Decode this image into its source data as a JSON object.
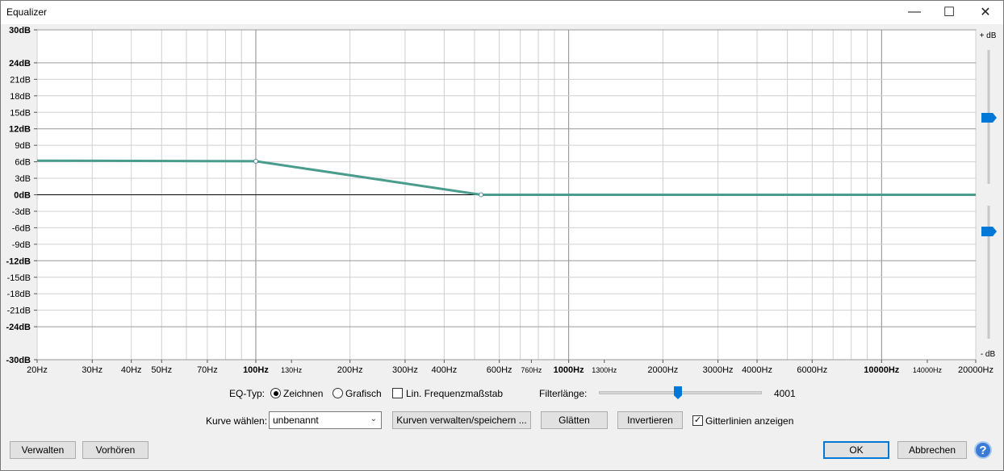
{
  "window": {
    "title": "Equalizer",
    "minimize": "—",
    "maximize": "☐",
    "close": "✕"
  },
  "graph": {
    "db_labels": [
      {
        "t": "30dB",
        "v": 30,
        "bold": true
      },
      {
        "t": "24dB",
        "v": 24,
        "bold": true
      },
      {
        "t": "21dB",
        "v": 21,
        "bold": false
      },
      {
        "t": "18dB",
        "v": 18,
        "bold": false
      },
      {
        "t": "15dB",
        "v": 15,
        "bold": false
      },
      {
        "t": "12dB",
        "v": 12,
        "bold": true
      },
      {
        "t": "9dB",
        "v": 9,
        "bold": false
      },
      {
        "t": "6dB",
        "v": 6,
        "bold": false
      },
      {
        "t": "3dB",
        "v": 3,
        "bold": false
      },
      {
        "t": "0dB",
        "v": 0,
        "bold": true
      },
      {
        "t": "-3dB",
        "v": -3,
        "bold": false
      },
      {
        "t": "-6dB",
        "v": -6,
        "bold": false
      },
      {
        "t": "-9dB",
        "v": -9,
        "bold": false
      },
      {
        "t": "-12dB",
        "v": -12,
        "bold": true
      },
      {
        "t": "-15dB",
        "v": -15,
        "bold": false
      },
      {
        "t": "-18dB",
        "v": -18,
        "bold": false
      },
      {
        "t": "-21dB",
        "v": -21,
        "bold": false
      },
      {
        "t": "-24dB",
        "v": -24,
        "bold": true
      },
      {
        "t": "-30dB",
        "v": -30,
        "bold": true
      }
    ],
    "freq_labels": [
      {
        "t": "20Hz",
        "f": 20,
        "size": "m",
        "bold": false
      },
      {
        "t": "30Hz",
        "f": 30,
        "size": "m",
        "bold": false
      },
      {
        "t": "40Hz",
        "f": 40,
        "size": "m",
        "bold": false
      },
      {
        "t": "50Hz",
        "f": 50,
        "size": "m",
        "bold": false
      },
      {
        "t": "70Hz",
        "f": 70,
        "size": "m",
        "bold": false
      },
      {
        "t": "100Hz",
        "f": 100,
        "size": "m",
        "bold": true
      },
      {
        "t": "130Hz",
        "f": 130,
        "size": "s",
        "bold": false
      },
      {
        "t": "200Hz",
        "f": 200,
        "size": "m",
        "bold": false
      },
      {
        "t": "300Hz",
        "f": 300,
        "size": "m",
        "bold": false
      },
      {
        "t": "400Hz",
        "f": 400,
        "size": "m",
        "bold": false
      },
      {
        "t": "600Hz",
        "f": 600,
        "size": "m",
        "bold": false
      },
      {
        "t": "760Hz",
        "f": 760,
        "size": "s",
        "bold": false
      },
      {
        "t": "1000Hz",
        "f": 1000,
        "size": "m",
        "bold": true
      },
      {
        "t": "1300Hz",
        "f": 1300,
        "size": "s",
        "bold": false
      },
      {
        "t": "2000Hz",
        "f": 2000,
        "size": "m",
        "bold": false
      },
      {
        "t": "3000Hz",
        "f": 3000,
        "size": "m",
        "bold": false
      },
      {
        "t": "4000Hz",
        "f": 4000,
        "size": "m",
        "bold": false
      },
      {
        "t": "6000Hz",
        "f": 6000,
        "size": "m",
        "bold": false
      },
      {
        "t": "10000Hz",
        "f": 10000,
        "size": "m",
        "bold": true
      },
      {
        "t": "14000Hz",
        "f": 14000,
        "size": "s",
        "bold": false
      },
      {
        "t": "20000Hz",
        "f": 20000,
        "size": "m",
        "bold": false
      }
    ],
    "curve": [
      {
        "f": 20,
        "db": 6.2
      },
      {
        "f": 100,
        "db": 6.1
      },
      {
        "f": 525,
        "db": 0
      },
      {
        "f": 20000,
        "db": 0
      }
    ],
    "plus_db_label": "+ dB",
    "minus_db_label": "- dB",
    "curve_color": "#4a9c8c"
  },
  "controls": {
    "eq_type_label": "EQ-Typ:",
    "draw_label": "Zeichnen",
    "graphic_label": "Grafisch",
    "eq_type_selected": "Zeichnen",
    "lin_freq_label": "Lin. Frequenzmaßstab",
    "lin_freq_checked": false,
    "filter_length_label": "Filterlänge:",
    "filter_length_value": "4001",
    "filter_length_fraction": 0.49,
    "choose_curve_label": "Kurve wählen:",
    "curve_value": "unbenannt",
    "manage_curves_label": "Kurven verwalten/speichern ...",
    "smooth_label": "Glätten",
    "invert_label": "Invertieren",
    "grid_label": "Gitterlinien anzeigen",
    "grid_checked": true
  },
  "footer": {
    "manage_label": "Verwalten",
    "preview_label": "Vorhören",
    "ok_label": "OK",
    "cancel_label": "Abbrechen",
    "help_label": "?"
  }
}
